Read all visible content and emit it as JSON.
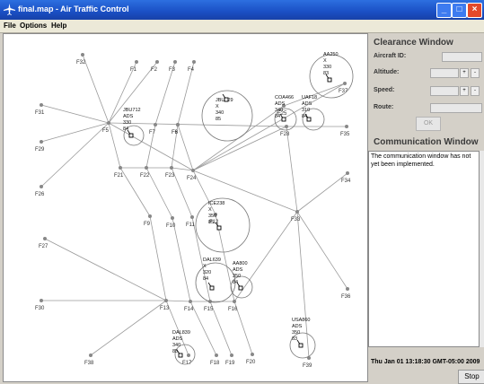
{
  "window": {
    "title": "final.map - Air Traffic Control"
  },
  "menu": [
    "File",
    "Options",
    "Help"
  ],
  "clearance": {
    "title": "Clearance Window",
    "aircraft_label": "Aircraft ID:",
    "altitude_label": "Altitude:",
    "speed_label": "Speed:",
    "route_label": "Route:",
    "ok_label": "OK"
  },
  "communication": {
    "title": "Communication Window",
    "message": "The communication window has not yet been implemented."
  },
  "status_time": "Thu Jan 01 13:18:30 GMT-05:00 2009",
  "stop_label": "Stop",
  "spin_up": "+",
  "spin_down": "-",
  "map": {
    "fixes": [
      {
        "id": "F32"
      },
      {
        "id": "F1"
      },
      {
        "id": "F2"
      },
      {
        "id": "F3"
      },
      {
        "id": "F4"
      },
      {
        "id": "F37"
      },
      {
        "id": "F31"
      },
      {
        "id": "F5"
      },
      {
        "id": "F6"
      },
      {
        "id": "F7"
      },
      {
        "id": "F8"
      },
      {
        "id": "F25"
      },
      {
        "id": "F28"
      },
      {
        "id": "F35"
      },
      {
        "id": "F21"
      },
      {
        "id": "F22"
      },
      {
        "id": "F23"
      },
      {
        "id": "F24"
      },
      {
        "id": "F34"
      },
      {
        "id": "F26"
      },
      {
        "id": "F33"
      },
      {
        "id": "F9"
      },
      {
        "id": "F10"
      },
      {
        "id": "F11"
      },
      {
        "id": "F12"
      },
      {
        "id": "F27"
      },
      {
        "id": "F36"
      },
      {
        "id": "F13"
      },
      {
        "id": "F14"
      },
      {
        "id": "F15"
      },
      {
        "id": "F16"
      },
      {
        "id": "F17"
      },
      {
        "id": "F18"
      },
      {
        "id": "F19"
      },
      {
        "id": "F20"
      },
      {
        "id": "F30"
      },
      {
        "id": "F38"
      },
      {
        "id": "F29"
      },
      {
        "id": "F39"
      }
    ],
    "aircraft": [
      {
        "tag": "AA250",
        "lines": [
          "AA250",
          "X",
          "330",
          "83"
        ]
      },
      {
        "tag": "JBU229",
        "lines": [
          "JBU229",
          "X",
          "340",
          "85"
        ]
      },
      {
        "tag": "COA466",
        "lines": [
          "COA466",
          "ADS",
          "340",
          "84"
        ]
      },
      {
        "tag": "UAF18",
        "lines": [
          "UAF18",
          "ADS",
          "310",
          "84"
        ]
      },
      {
        "tag": "JBU712",
        "lines": [
          "JBU712",
          "ADS",
          "330",
          "84"
        ]
      },
      {
        "tag": "ICE238",
        "lines": [
          "ICE238",
          "X",
          "350",
          "85"
        ]
      },
      {
        "tag": "DAL639",
        "lines": [
          "DAL639",
          "X",
          "320",
          "84"
        ]
      },
      {
        "tag": "AA800",
        "lines": [
          "AA800",
          "ADS",
          "350",
          "84"
        ]
      },
      {
        "tag": "USA860",
        "lines": [
          "USA860",
          "ADS",
          "350",
          "83"
        ]
      },
      {
        "tag": "DAL839",
        "lines": [
          "DAL839",
          "ADS",
          "340",
          "85"
        ]
      }
    ]
  }
}
